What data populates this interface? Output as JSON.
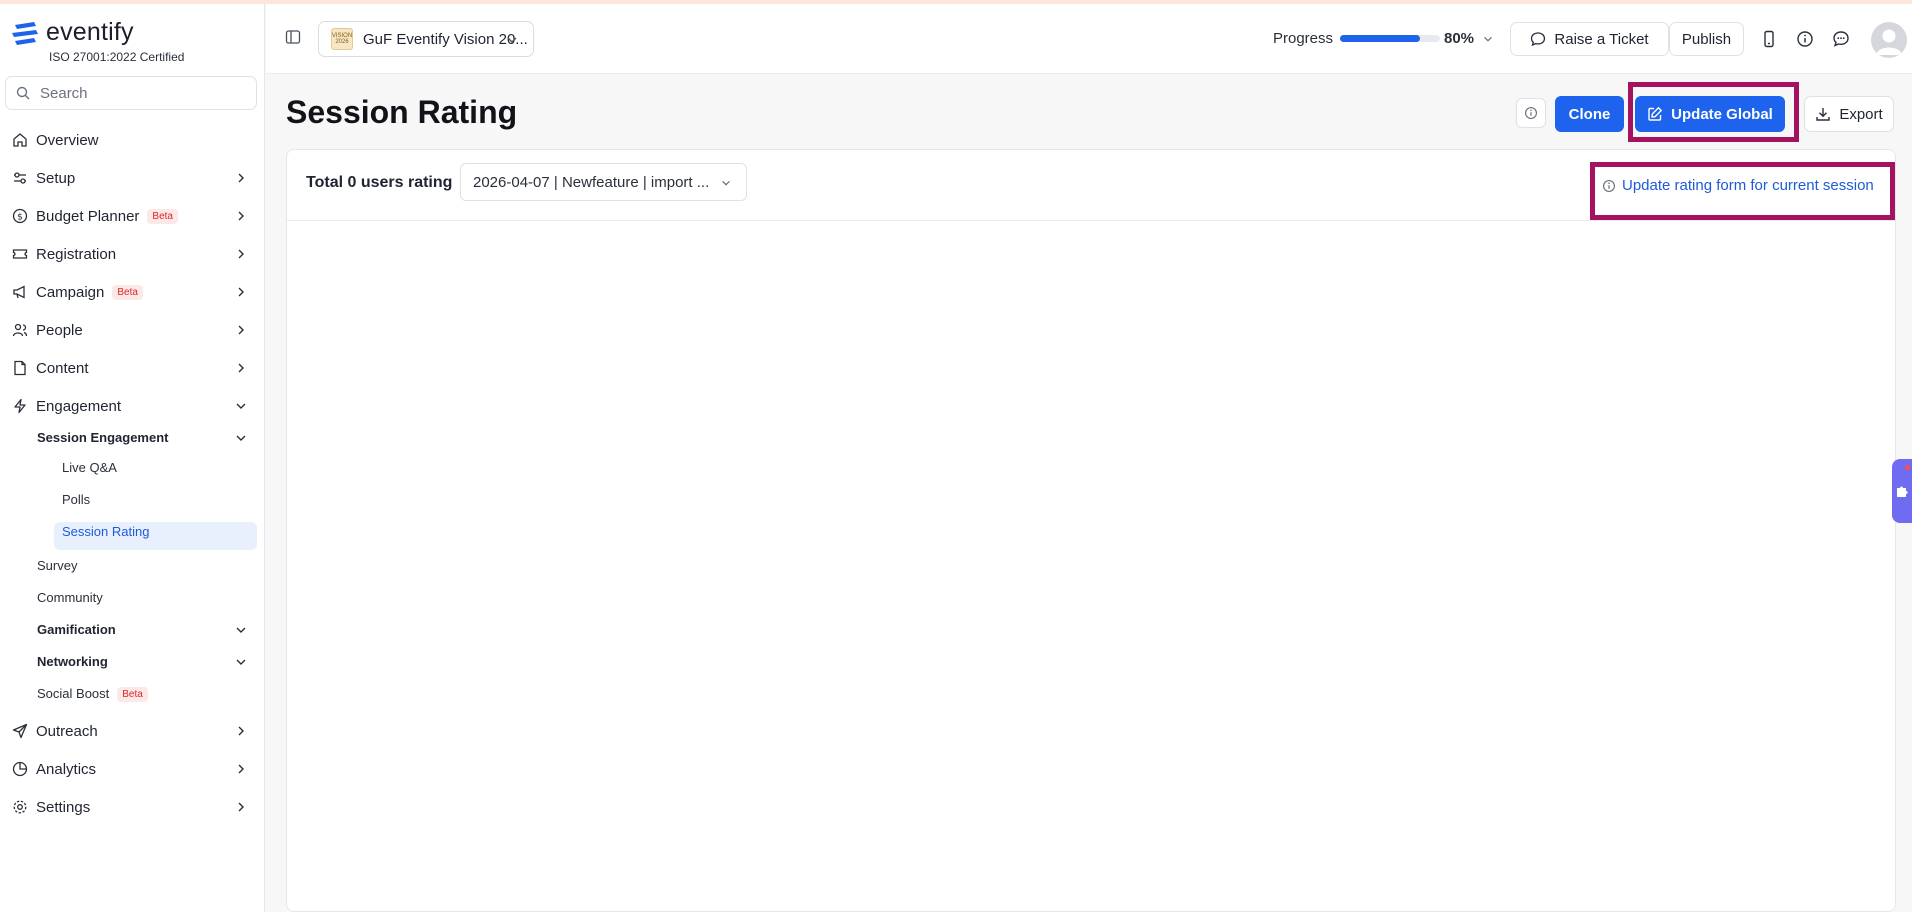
{
  "brand": {
    "name": "eventify",
    "certification": "ISO 27001:2022 Certified",
    "accent": "#1d63ed"
  },
  "search": {
    "placeholder": "Search"
  },
  "sidebar": {
    "items": [
      {
        "label": "Overview",
        "icon": "home-icon"
      },
      {
        "label": "Setup",
        "icon": "sliders-icon"
      },
      {
        "label": "Budget Planner",
        "icon": "dollar-icon",
        "badge": "Beta"
      },
      {
        "label": "Registration",
        "icon": "ticket-icon"
      },
      {
        "label": "Campaign",
        "icon": "megaphone-icon",
        "badge": "Beta"
      },
      {
        "label": "People",
        "icon": "users-icon"
      },
      {
        "label": "Content",
        "icon": "file-icon"
      },
      {
        "label": "Engagement",
        "icon": "bolt-icon"
      },
      {
        "label": "Outreach",
        "icon": "send-icon"
      },
      {
        "label": "Analytics",
        "icon": "pie-chart-icon"
      },
      {
        "label": "Settings",
        "icon": "gear-icon"
      }
    ],
    "engagement": {
      "session_engagement": "Session Engagement",
      "session_children": [
        "Live Q&A",
        "Polls",
        "Session Rating"
      ],
      "survey": "Survey",
      "community": "Community",
      "gamification": "Gamification",
      "networking": "Networking",
      "social_boost": "Social Boost",
      "social_boost_badge": "Beta"
    }
  },
  "header": {
    "event_name": "GuF Eventify Vision 20...",
    "event_thumb": "VISION 2026",
    "progress_label": "Progress",
    "progress_value": 80,
    "progress_text": "80%",
    "raise_ticket": "Raise a Ticket",
    "publish": "Publish"
  },
  "page": {
    "title": "Session Rating",
    "clone": "Clone",
    "update_global": "Update Global",
    "export": "Export",
    "total_rating": "Total 0 users rating",
    "session_selected": "2026-04-07 | Newfeature | import ...",
    "update_form_link": "Update rating form for current session"
  }
}
